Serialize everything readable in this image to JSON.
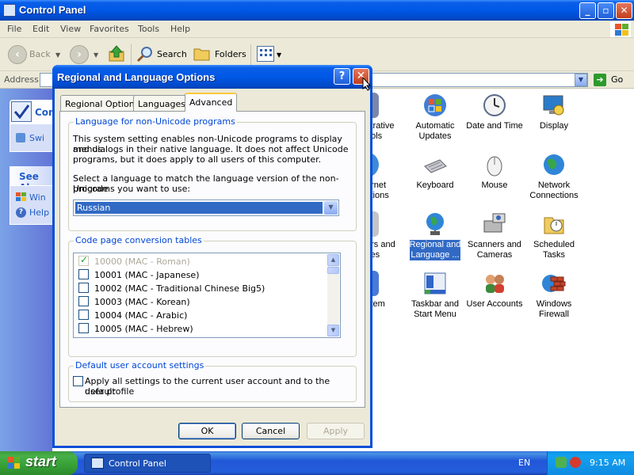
{
  "window": {
    "title": "Control Panel",
    "caption_buttons": {
      "minimize": "_",
      "maximize": "▫",
      "close": "✕"
    }
  },
  "menubar": [
    "File",
    "Edit",
    "View",
    "Favorites",
    "Tools",
    "Help"
  ],
  "toolbar": {
    "back_label": "Back",
    "search_label": "Search",
    "folders_label": "Folders"
  },
  "address_bar": {
    "label": "Address",
    "value": "",
    "go_label": "Go"
  },
  "task_pane": {
    "panel_header": "Contr",
    "switch_link": "Swi",
    "see_also_header": "See Als",
    "links": [
      "Win",
      "Help"
    ]
  },
  "control_panel_items": [
    {
      "label": "Administrative Tools",
      "visible_label": "strative\nools",
      "icon": "admin-tools-icon"
    },
    {
      "label": "Automatic Updates",
      "visible_label": "Automatic\nUpdates",
      "icon": "windows-update-icon"
    },
    {
      "label": "Date and Time",
      "visible_label": "Date and Time",
      "icon": "clock-icon"
    },
    {
      "label": "Display",
      "visible_label": "Display",
      "icon": "display-icon"
    },
    {
      "label": "Internet Options",
      "visible_label": "ernet\nctions",
      "icon": "internet-globe-icon"
    },
    {
      "label": "Keyboard",
      "visible_label": "Keyboard",
      "icon": "keyboard-icon"
    },
    {
      "label": "Mouse",
      "visible_label": "Mouse",
      "icon": "mouse-icon"
    },
    {
      "label": "Network Connections",
      "visible_label": "Network\nConnections",
      "icon": "network-globe-icon"
    },
    {
      "label": "Printers and Faxes",
      "visible_label": "ers and\nxes",
      "icon": "printer-icon"
    },
    {
      "label": "Regional and Language Options",
      "visible_label": "Regional and\nLanguage ...",
      "icon": "regional-globe-icon",
      "selected": true
    },
    {
      "label": "Scanners and Cameras",
      "visible_label": "Scanners and\nCameras",
      "icon": "scanner-camera-icon"
    },
    {
      "label": "Scheduled Tasks",
      "visible_label": "Scheduled\nTasks",
      "icon": "scheduled-tasks-icon"
    },
    {
      "label": "System",
      "visible_label": "stem",
      "icon": "system-icon"
    },
    {
      "label": "Taskbar and Start Menu",
      "visible_label": "Taskbar and\nStart Menu",
      "icon": "taskbar-icon"
    },
    {
      "label": "User Accounts",
      "visible_label": "User Accounts",
      "icon": "users-icon"
    },
    {
      "label": "Windows Firewall",
      "visible_label": "Windows\nFirewall",
      "icon": "firewall-icon"
    }
  ],
  "dialog": {
    "title": "Regional and Language Options",
    "help_glyph": "?",
    "close_glyph": "✕",
    "tabs": [
      {
        "label": "Regional Options",
        "active": false
      },
      {
        "label": "Languages",
        "active": false
      },
      {
        "label": "Advanced",
        "active": true
      }
    ],
    "non_unicode": {
      "group_title": "Language for non-Unicode programs",
      "description_lines": [
        "This system setting enables non-Unicode programs to display menus",
        "and dialogs in their native language. It does not affect Unicode",
        "programs, but it does apply to all users of this computer."
      ],
      "prompt_lines": [
        "Select a language to match the language version of the non-Unicode",
        "programs you want to use:"
      ],
      "selected_language": "Russian"
    },
    "code_pages": {
      "group_title": "Code page conversion tables",
      "items": [
        {
          "label": "10000 (MAC - Roman)",
          "checked": true,
          "disabled": true
        },
        {
          "label": "10001 (MAC - Japanese)",
          "checked": false,
          "disabled": false
        },
        {
          "label": "10002 (MAC - Traditional Chinese Big5)",
          "checked": false,
          "disabled": false
        },
        {
          "label": "10003 (MAC - Korean)",
          "checked": false,
          "disabled": false
        },
        {
          "label": "10004 (MAC - Arabic)",
          "checked": false,
          "disabled": false
        },
        {
          "label": "10005 (MAC - Hebrew)",
          "checked": false,
          "disabled": false
        }
      ]
    },
    "default_user": {
      "group_title": "Default user account settings",
      "checkbox_lines": [
        "Apply all settings to the current user account and to the default",
        "user profile"
      ],
      "checked": false
    },
    "buttons": {
      "ok": "OK",
      "cancel": "Cancel",
      "apply": "Apply"
    }
  },
  "taskbar": {
    "start_label": "start",
    "task_button": "Control Panel",
    "language": "EN",
    "clock": "9:15 AM"
  }
}
